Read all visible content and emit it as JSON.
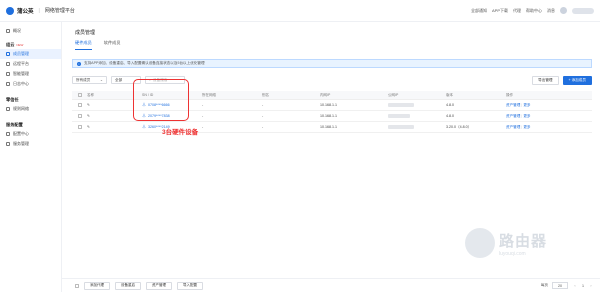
{
  "app": {
    "brand": "蒲公英",
    "subtitle": "网络管理平台",
    "top_links": [
      "全部通知",
      "APP下载",
      "代理",
      "帮助中心",
      "消息"
    ]
  },
  "sidebar": {
    "items": [
      {
        "label": "概况"
      }
    ],
    "groups": [
      {
        "title": "组云",
        "badge": "NEW",
        "items": [
          {
            "label": "成员管理",
            "active": true
          },
          {
            "label": "远程平台"
          },
          {
            "label": "智能管理"
          },
          {
            "label": "日志中心"
          }
        ]
      },
      {
        "title": "零信任",
        "items": [
          {
            "label": "规则网络"
          }
        ]
      },
      {
        "title": "服务配置",
        "items": [
          {
            "label": "配置中心"
          },
          {
            "label": "服务管理"
          }
        ]
      }
    ]
  },
  "main": {
    "title": "成员管理",
    "tabs": [
      {
        "label": "硬件成员",
        "active": true
      },
      {
        "label": "软件成员"
      }
    ],
    "notice": "支持APP添加、设备重启、导入配置确认设备连接状态以及5台以上优化管理",
    "filters": {
      "type_select": "所有成员",
      "status_select": "全部",
      "search_placeholder": "设备搜索"
    },
    "buttons": {
      "batch": "导出管理",
      "add": "+ 添加成员"
    },
    "table": {
      "columns": [
        "名称",
        "SN / ID",
        "所在网络",
        "别名",
        "内网IP",
        "公网IP",
        "版本",
        "操作"
      ],
      "rows": [
        {
          "sn": "0708****6666",
          "network": "-",
          "alias": "-",
          "lan_ip": "10.168.1.1",
          "version": "4.8.0",
          "actions": [
            "资产管理",
            "更多"
          ]
        },
        {
          "sn": "2079****7838",
          "network": "-",
          "alias": "-",
          "lan_ip": "10.168.1.1",
          "version": "4.8.0",
          "actions": [
            "资产管理",
            "更多"
          ]
        },
        {
          "sn": "3260****2149",
          "network": "-",
          "alias": "-",
          "lan_ip": "10.168.1.1",
          "version": "3.20.0（4.8.0）",
          "actions": [
            "资产管理",
            "更多"
          ]
        }
      ]
    }
  },
  "annotation": "3台硬件设备",
  "footer": {
    "buttons": [
      "添加代理",
      "设备重启",
      "资产管理",
      "导入配置"
    ],
    "pager_label": "每页",
    "page_size": "20",
    "current_page": "1"
  },
  "watermark": {
    "big": "路由器",
    "small": "luyouqi.com"
  }
}
